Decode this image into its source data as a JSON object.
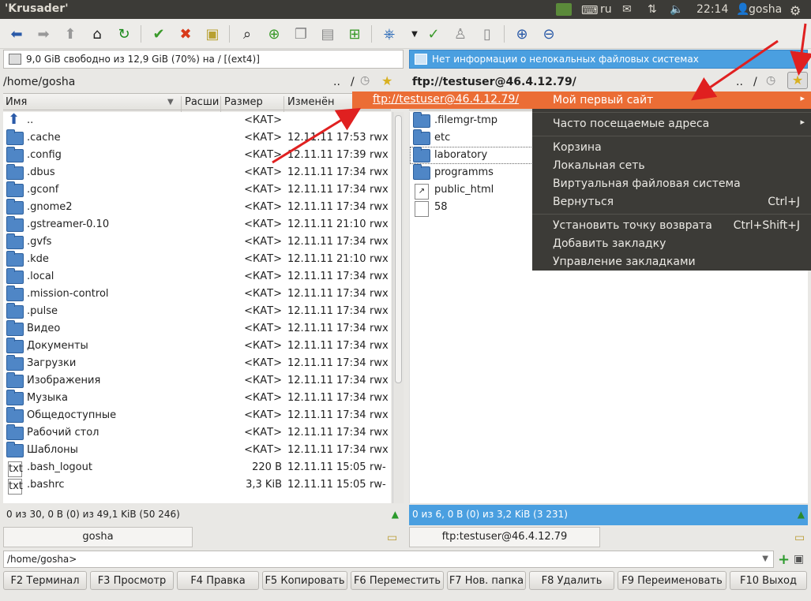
{
  "topbar": {
    "title": "'Krusader'",
    "lang": "ru",
    "time": "22:14",
    "user": "gosha"
  },
  "left": {
    "status": "9,0 GiB свободно из 12,9 GiB (70%) на / [(ext4)]",
    "path": "/home/gosha",
    "path_dots": "..",
    "path_slash": "/",
    "columns": {
      "name": "Имя",
      "ext": "Расши",
      "size": "Размер",
      "modified": "Изменён"
    },
    "rows": [
      {
        "name": "..",
        "size": "<КАТ>",
        "date": "",
        "perm": "",
        "type": "up"
      },
      {
        "name": ".cache",
        "size": "<КАТ>",
        "date": "12.11.11 17:53",
        "perm": "rwx",
        "type": "folder"
      },
      {
        "name": ".config",
        "size": "<КАТ>",
        "date": "12.11.11 17:39",
        "perm": "rwx",
        "type": "folder"
      },
      {
        "name": ".dbus",
        "size": "<КАТ>",
        "date": "12.11.11 17:34",
        "perm": "rwx",
        "type": "folder"
      },
      {
        "name": ".gconf",
        "size": "<КАТ>",
        "date": "12.11.11 17:34",
        "perm": "rwx",
        "type": "folder"
      },
      {
        "name": ".gnome2",
        "size": "<КАТ>",
        "date": "12.11.11 17:34",
        "perm": "rwx",
        "type": "folder"
      },
      {
        "name": ".gstreamer-0.10",
        "size": "<КАТ>",
        "date": "12.11.11 21:10",
        "perm": "rwx",
        "type": "folder"
      },
      {
        "name": ".gvfs",
        "size": "<КАТ>",
        "date": "12.11.11 17:34",
        "perm": "rwx",
        "type": "folder"
      },
      {
        "name": ".kde",
        "size": "<КАТ>",
        "date": "12.11.11 21:10",
        "perm": "rwx",
        "type": "folder"
      },
      {
        "name": ".local",
        "size": "<КАТ>",
        "date": "12.11.11 17:34",
        "perm": "rwx",
        "type": "folder"
      },
      {
        "name": ".mission-control",
        "size": "<КАТ>",
        "date": "12.11.11 17:34",
        "perm": "rwx",
        "type": "folder"
      },
      {
        "name": ".pulse",
        "size": "<КАТ>",
        "date": "12.11.11 17:34",
        "perm": "rwx",
        "type": "folder"
      },
      {
        "name": "Видео",
        "size": "<КАТ>",
        "date": "12.11.11 17:34",
        "perm": "rwx",
        "type": "folder"
      },
      {
        "name": "Документы",
        "size": "<КАТ>",
        "date": "12.11.11 17:34",
        "perm": "rwx",
        "type": "folder"
      },
      {
        "name": "Загрузки",
        "size": "<КАТ>",
        "date": "12.11.11 17:34",
        "perm": "rwx",
        "type": "folder"
      },
      {
        "name": "Изображения",
        "size": "<КАТ>",
        "date": "12.11.11 17:34",
        "perm": "rwx",
        "type": "folder"
      },
      {
        "name": "Музыка",
        "size": "<КАТ>",
        "date": "12.11.11 17:34",
        "perm": "rwx",
        "type": "folder"
      },
      {
        "name": "Общедоступные",
        "size": "<КАТ>",
        "date": "12.11.11 17:34",
        "perm": "rwx",
        "type": "folder"
      },
      {
        "name": "Рабочий стол",
        "size": "<КАТ>",
        "date": "12.11.11 17:34",
        "perm": "rwx",
        "type": "folder"
      },
      {
        "name": "Шаблоны",
        "size": "<КАТ>",
        "date": "12.11.11 17:34",
        "perm": "rwx",
        "type": "folder"
      },
      {
        "name": ".bash_logout",
        "size": "220 B",
        "date": "12.11.11 15:05",
        "perm": "rw-",
        "type": "txt"
      },
      {
        "name": ".bashrc",
        "size": "3,3 KiB",
        "date": "12.11.11 15:05",
        "perm": "rw-",
        "type": "txt"
      }
    ],
    "totals": "0 из 30, 0 B (0) из 49,1 KiB (50 246)",
    "tab": "gosha"
  },
  "right": {
    "status": "Нет информации о нелокальных файловых системах",
    "path": "ftp://testuser@46.4.12.79/",
    "path_dots": "..",
    "path_slash": "/",
    "rows": [
      {
        "name": ".filemgr-tmp",
        "type": "folder"
      },
      {
        "name": "etc",
        "type": "folder"
      },
      {
        "name": "laboratory",
        "type": "folder"
      },
      {
        "name": "programms",
        "type": "folder"
      },
      {
        "name": "public_html",
        "type": "link"
      },
      {
        "name": "58",
        "type": "file"
      }
    ],
    "totals": "0 из 6, 0 B (0) из 3,2 KiB (3 231)",
    "tab": "ftp:testuser@46.4.12.79"
  },
  "ftp_item": "ftp://testuser@46.4.12.79/",
  "bookmarks_menu": {
    "items": [
      {
        "label": "Мой первый сайт",
        "shortcut": "",
        "submenu": true
      },
      {
        "label": "Часто посещаемые адреса",
        "shortcut": "",
        "submenu": true
      },
      {
        "label": "Корзина",
        "shortcut": ""
      },
      {
        "label": "Локальная сеть",
        "shortcut": ""
      },
      {
        "label": "Виртуальная файловая система",
        "shortcut": ""
      },
      {
        "label": "Вернуться",
        "shortcut": "Ctrl+J"
      },
      {
        "label": "Установить точку возврата",
        "shortcut": "Ctrl+Shift+J"
      },
      {
        "label": "Добавить закладку",
        "shortcut": ""
      },
      {
        "label": "Управление закладками",
        "shortcut": ""
      }
    ]
  },
  "cmdline": {
    "prompt": "/home/gosha>"
  },
  "fkeys": [
    {
      "key": "F2",
      "label": " Терминал"
    },
    {
      "key": "F3",
      "label": " Просмотр"
    },
    {
      "key": "F4",
      "label": " Правка"
    },
    {
      "key": "F5",
      "label": " Копировать"
    },
    {
      "key": "F6",
      "label": " Переместить"
    },
    {
      "key": "F7",
      "label": " Нов. папка"
    },
    {
      "key": "F8",
      "label": " Удалить"
    },
    {
      "key": "F9",
      "label": " Переименовать"
    },
    {
      "key": "F10",
      "label": " Выход"
    }
  ],
  "colors": {
    "accent": "#eb6d35",
    "status_active": "#4a9fe0",
    "menu_bg": "#3c3b37",
    "arrow": "#e02020"
  }
}
